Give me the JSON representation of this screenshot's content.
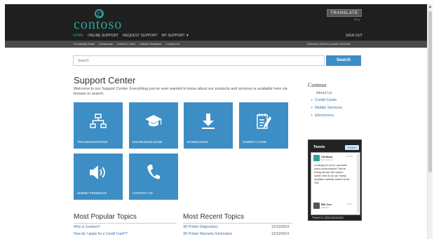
{
  "header": {
    "logo_text": "contoso",
    "translate_label": "TRANSLATE",
    "bing_label": "Bing",
    "nav": [
      "HOME",
      "ONLINE SUPPORT",
      "REQUEST SUPPORT",
      "MY SUPPORT ▼"
    ],
    "sign_out": "SIGN OUT"
  },
  "subnav": {
    "links": [
      "Knowledge Base",
      "Downloads",
      "Submit a Case",
      "Submit Feedback",
      "Contact Us"
    ],
    "welcome": "Welcome Vincent Laurant VincentL"
  },
  "search": {
    "placeholder": "Search",
    "button": "Search"
  },
  "main": {
    "title": "Support Center",
    "intro": "Welcome to our Support Center. Everything you've ever wanted to know about our products and services is available here via browse or search.",
    "tiles": [
      {
        "label": "TROUBLESHOOTER",
        "icon": "sitemap-icon"
      },
      {
        "label": "KNOWLEDGE BASE",
        "icon": "graduation-cap-icon"
      },
      {
        "label": "DOWNLOADS",
        "icon": "download-icon"
      },
      {
        "label": "SUBMIT A CASE",
        "icon": "notepad-icon"
      },
      {
        "label": "SUBMIT FEEDBACK",
        "icon": "speaker-icon"
      },
      {
        "label": "CONTACT US",
        "icon": "phone-icon"
      }
    ],
    "popular_title": "Most Popular Topics",
    "popular": [
      "Who is Contoso?",
      "How do I apply for a Credit Card??"
    ],
    "recent_title": "Most Recent Topics",
    "recent": [
      {
        "title": "3D Printer Diagnostics",
        "date": "12/12/2014"
      },
      {
        "title": "3D Printer Warranty Information",
        "date": "12/12/2014"
      }
    ]
  },
  "sidebar": {
    "title": "Contoso",
    "about": "About Us",
    "items": [
      "Credit Cards",
      "Mobile Services",
      "Electronics"
    ]
  },
  "tweets": {
    "title": "Tweets",
    "follow": "Follow",
    "items": [
      {
        "name": "Contoso",
        "handle": "@Contosoinc",
        "date": "20 Feb",
        "text": "Looking for a fun, dynamic work environment? We're hiring across the board, come visit us at our newly updated 'activity based work' HQ!"
      },
      {
        "name": "Bill Cox",
        "handle": "@billcox",
        "date": "6 Nov",
        "text": ""
      }
    ],
    "tweet_to": "Tweet to @Contosoinc"
  },
  "colors": {
    "accent": "#2fa29a",
    "tile_blue": "#3c8ec4",
    "header_bg": "#1f1f1f"
  }
}
